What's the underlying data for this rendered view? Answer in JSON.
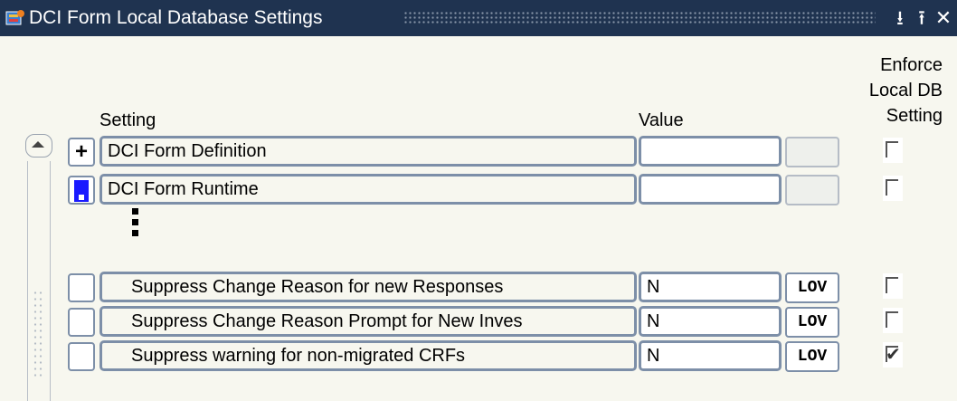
{
  "window": {
    "title": "DCI Form Local Database Settings",
    "controls": [
      "minimize-icon",
      "maximize-icon",
      "close-icon"
    ]
  },
  "headers": {
    "setting": "Setting",
    "value": "Value",
    "enforce_line1": "Enforce",
    "enforce_line2": "Local DB",
    "enforce_line3": "Setting"
  },
  "groups": [
    {
      "expander": "+",
      "label": "DCI Form Definition",
      "value": ""
    },
    {
      "expander": "",
      "label": "DCI Form Runtime",
      "value": "",
      "selected": true
    }
  ],
  "settings": [
    {
      "label": "Suppress Change Reason for new Responses",
      "value": "N",
      "lov": "LOV",
      "enforce": false
    },
    {
      "label": "Suppress Change Reason Prompt for New Inves",
      "value": "N",
      "lov": "LOV",
      "enforce": false
    },
    {
      "label": "Suppress warning for non-migrated CRFs",
      "value": "N",
      "lov": "LOV",
      "enforce": true
    }
  ],
  "colors": {
    "titlebar": "#1f3350",
    "field_border": "#7d8fa8",
    "row_marker": "#1a1aff",
    "background": "#f7f7ef"
  }
}
